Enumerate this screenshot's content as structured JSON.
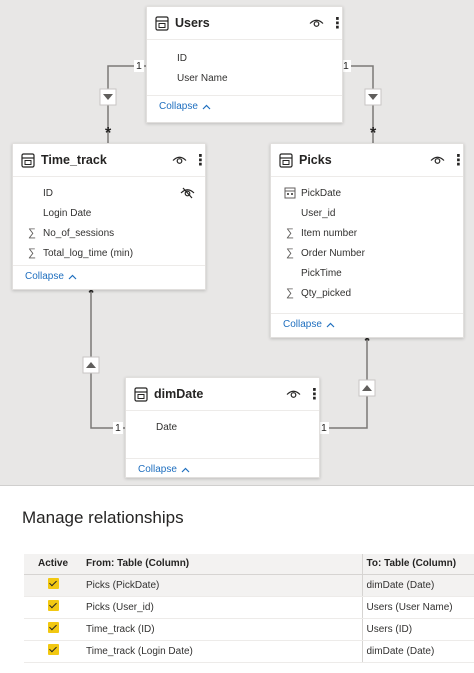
{
  "model_view": {
    "tables": [
      {
        "name": "Users",
        "collapse_label": "Collapse",
        "fields": [
          {
            "name": "ID",
            "icon": "none"
          },
          {
            "name": "User Name",
            "icon": "none"
          }
        ]
      },
      {
        "name": "Time_track",
        "collapse_label": "Collapse",
        "fields": [
          {
            "name": "ID",
            "icon": "none",
            "hidden": true
          },
          {
            "name": "Login Date",
            "icon": "none"
          },
          {
            "name": "No_of_sessions",
            "icon": "sigma-icon"
          },
          {
            "name": "Total_log_time (min)",
            "icon": "sigma-icon"
          }
        ]
      },
      {
        "name": "Picks",
        "collapse_label": "Collapse",
        "fields": [
          {
            "name": "PickDate",
            "icon": "calendar-icon"
          },
          {
            "name": "User_id",
            "icon": "none"
          },
          {
            "name": "Item number",
            "icon": "sigma-icon"
          },
          {
            "name": "Order Number",
            "icon": "sigma-icon"
          },
          {
            "name": "PickTime",
            "icon": "none"
          },
          {
            "name": "Qty_picked",
            "icon": "sigma-icon"
          }
        ]
      },
      {
        "name": "dimDate",
        "collapse_label": "Collapse",
        "fields": [
          {
            "name": "Date",
            "icon": "none"
          }
        ]
      }
    ],
    "cardinality": {
      "one": "1",
      "many": "*"
    }
  },
  "manage": {
    "title": "Manage relationships",
    "columns": {
      "active": "Active",
      "from": "From: Table (Column)",
      "to": "To: Table (Column)"
    },
    "rows": [
      {
        "active": true,
        "from": "Picks (PickDate)",
        "to": "dimDate (Date)"
      },
      {
        "active": true,
        "from": "Picks (User_id)",
        "to": "Users (User Name)"
      },
      {
        "active": true,
        "from": "Time_track (ID)",
        "to": "Users (ID)"
      },
      {
        "active": true,
        "from": "Time_track (Login Date)",
        "to": "dimDate (Date)"
      }
    ]
  },
  "colors": {
    "canvas": "#e8e7e6",
    "link": "#1f6fbf",
    "checkbox": "#f2c811",
    "line": "#7a7876"
  }
}
